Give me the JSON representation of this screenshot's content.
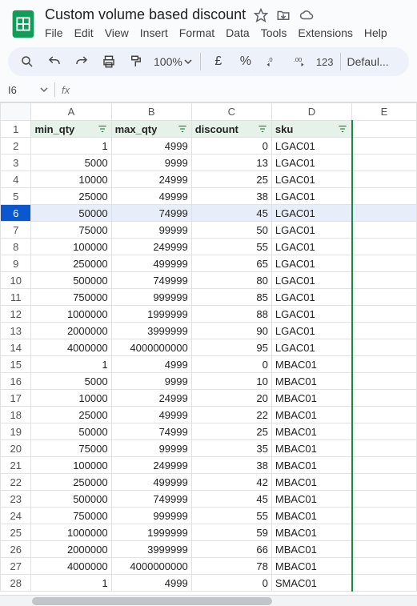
{
  "doc": {
    "title": "Custom volume based discount"
  },
  "menus": [
    "File",
    "Edit",
    "View",
    "Insert",
    "Format",
    "Data",
    "Tools",
    "Extensions",
    "Help"
  ],
  "toolbar": {
    "zoom": "100%",
    "currency": "£",
    "percent": "%",
    "num123": "123",
    "font": "Defaul..."
  },
  "namebox": {
    "cell": "I6"
  },
  "columns": [
    "A",
    "B",
    "C",
    "D",
    "E"
  ],
  "headers": {
    "A": "min_qty",
    "B": "max_qty",
    "C": "discount",
    "D": "sku"
  },
  "selected_row_header": 6,
  "rows": [
    {
      "n": 1
    },
    {
      "n": 2,
      "a": "1",
      "b": "4999",
      "c": "0",
      "d": "LGAC01"
    },
    {
      "n": 3,
      "a": "5000",
      "b": "9999",
      "c": "13",
      "d": "LGAC01"
    },
    {
      "n": 4,
      "a": "10000",
      "b": "24999",
      "c": "25",
      "d": "LGAC01"
    },
    {
      "n": 5,
      "a": "25000",
      "b": "49999",
      "c": "38",
      "d": "LGAC01"
    },
    {
      "n": 6,
      "a": "50000",
      "b": "74999",
      "c": "45",
      "d": "LGAC01"
    },
    {
      "n": 7,
      "a": "75000",
      "b": "99999",
      "c": "50",
      "d": "LGAC01"
    },
    {
      "n": 8,
      "a": "100000",
      "b": "249999",
      "c": "55",
      "d": "LGAC01"
    },
    {
      "n": 9,
      "a": "250000",
      "b": "499999",
      "c": "65",
      "d": "LGAC01"
    },
    {
      "n": 10,
      "a": "500000",
      "b": "749999",
      "c": "80",
      "d": "LGAC01"
    },
    {
      "n": 11,
      "a": "750000",
      "b": "999999",
      "c": "85",
      "d": "LGAC01"
    },
    {
      "n": 12,
      "a": "1000000",
      "b": "1999999",
      "c": "88",
      "d": "LGAC01"
    },
    {
      "n": 13,
      "a": "2000000",
      "b": "3999999",
      "c": "90",
      "d": "LGAC01"
    },
    {
      "n": 14,
      "a": "4000000",
      "b": "4000000000",
      "c": "95",
      "d": "LGAC01"
    },
    {
      "n": 15,
      "a": "1",
      "b": "4999",
      "c": "0",
      "d": "MBAC01"
    },
    {
      "n": 16,
      "a": "5000",
      "b": "9999",
      "c": "10",
      "d": "MBAC01"
    },
    {
      "n": 17,
      "a": "10000",
      "b": "24999",
      "c": "20",
      "d": "MBAC01"
    },
    {
      "n": 18,
      "a": "25000",
      "b": "49999",
      "c": "22",
      "d": "MBAC01"
    },
    {
      "n": 19,
      "a": "50000",
      "b": "74999",
      "c": "25",
      "d": "MBAC01"
    },
    {
      "n": 20,
      "a": "75000",
      "b": "99999",
      "c": "35",
      "d": "MBAC01"
    },
    {
      "n": 21,
      "a": "100000",
      "b": "249999",
      "c": "38",
      "d": "MBAC01"
    },
    {
      "n": 22,
      "a": "250000",
      "b": "499999",
      "c": "42",
      "d": "MBAC01"
    },
    {
      "n": 23,
      "a": "500000",
      "b": "749999",
      "c": "45",
      "d": "MBAC01"
    },
    {
      "n": 24,
      "a": "750000",
      "b": "999999",
      "c": "55",
      "d": "MBAC01"
    },
    {
      "n": 25,
      "a": "1000000",
      "b": "1999999",
      "c": "59",
      "d": "MBAC01"
    },
    {
      "n": 26,
      "a": "2000000",
      "b": "3999999",
      "c": "66",
      "d": "MBAC01"
    },
    {
      "n": 27,
      "a": "4000000",
      "b": "4000000000",
      "c": "78",
      "d": "MBAC01"
    },
    {
      "n": 28,
      "a": "1",
      "b": "4999",
      "c": "0",
      "d": "SMAC01"
    }
  ]
}
